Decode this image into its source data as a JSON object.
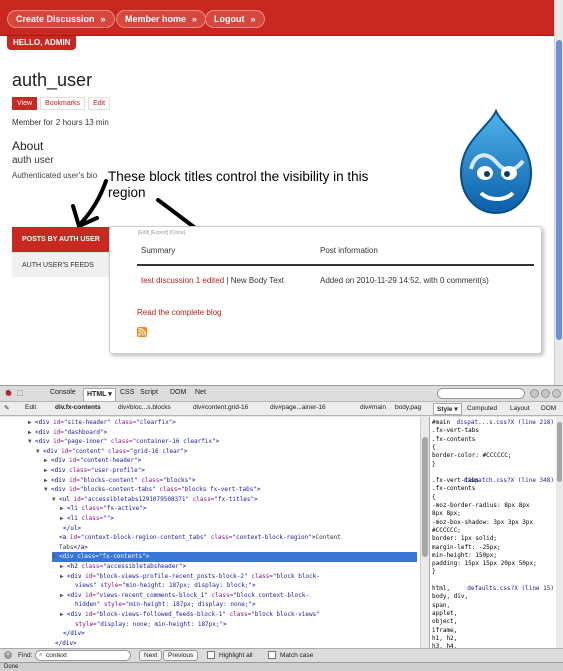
{
  "nav": {
    "create_discussion": "Create Discussion",
    "member_home": "Member home",
    "logout": "Logout",
    "hello": "HELLO, ADMIN"
  },
  "profile": {
    "title": "auth_user",
    "tabs": [
      "View",
      "Bookmarks",
      "Edit"
    ],
    "member_for_label": "Member for",
    "member_for_value": "2 hours 13 min",
    "about_heading": "About",
    "about_name": "auth user",
    "about_bio": "Authenticated user's bio"
  },
  "annotation": {
    "text": "These block titles control the visibility in this region"
  },
  "side_blocks": {
    "active": "POSTS BY AUTH USER",
    "inactive": "AUTH USER'S FEEDS"
  },
  "content": {
    "mini_links": "[Edit]  [Export]  [Clone]",
    "col_summary": "Summary",
    "col_post_info": "Post information",
    "row_link": "test discussion 1 edited",
    "row_separator": " | ",
    "row_body": "New Body Text",
    "row_info": "Added on 2010-11-29 14:52, with 0 comment(s)",
    "read_blog": "Read the complete blog"
  },
  "firebug": {
    "tabs": {
      "console": "Console",
      "html": "HTML ▾",
      "css": "CSS",
      "script": "Script",
      "dom": "DOM",
      "net": "Net"
    },
    "edit": "Edit",
    "breadcrumbs": [
      "div.fx-contents",
      "div#bloc...s.blocks",
      "div#content.grid-16",
      "div#page...ainer-16",
      "div#main",
      "body.pag"
    ],
    "side_tabs": {
      "style": "Style ▾",
      "computed": "Computed",
      "layout": "Layout",
      "dom": "DOM"
    },
    "find_label": "Find:",
    "find_value": "context",
    "find_next": "Next",
    "find_previous": "Previous",
    "highlight_all": "Highlight all",
    "match_case": "Match case",
    "status": "Done",
    "html_lines": [
      {
        "indent": 7,
        "tri": "▶",
        "parts": [
          [
            "tag",
            "<div "
          ],
          [
            "an",
            "id="
          ],
          [
            "av",
            "\"site-header\""
          ],
          [
            "an",
            " class="
          ],
          [
            "av",
            "\"clearfix\""
          ],
          [
            "tag",
            ">"
          ]
        ]
      },
      {
        "indent": 7,
        "tri": "▶",
        "parts": [
          [
            "tag",
            "<div "
          ],
          [
            "an",
            "id="
          ],
          [
            "av",
            "\"dashboard\""
          ],
          [
            "tag",
            ">"
          ]
        ]
      },
      {
        "indent": 7,
        "tri": "▼",
        "parts": [
          [
            "tag",
            "<div "
          ],
          [
            "an",
            "id="
          ],
          [
            "av",
            "\"page-inner\""
          ],
          [
            "an",
            " class="
          ],
          [
            "av",
            "\"container-16 clearfix\""
          ],
          [
            "tag",
            ">"
          ]
        ]
      },
      {
        "indent": 9,
        "tri": "▼",
        "parts": [
          [
            "tag",
            "<div "
          ],
          [
            "an",
            "id="
          ],
          [
            "av",
            "\"content\""
          ],
          [
            "an",
            " class="
          ],
          [
            "av",
            "\"grid-16 clear\""
          ],
          [
            "tag",
            ">"
          ]
        ]
      },
      {
        "indent": 11,
        "tri": "▶",
        "parts": [
          [
            "tag",
            "<div "
          ],
          [
            "an",
            "id="
          ],
          [
            "av",
            "\"content-header\""
          ],
          [
            "tag",
            ">"
          ]
        ]
      },
      {
        "indent": 11,
        "tri": "▶",
        "parts": [
          [
            "tag",
            "<div "
          ],
          [
            "an",
            "class="
          ],
          [
            "av",
            "\"user-profile\""
          ],
          [
            "tag",
            ">"
          ]
        ]
      },
      {
        "indent": 11,
        "tri": "▶",
        "parts": [
          [
            "tag",
            "<div "
          ],
          [
            "an",
            "id="
          ],
          [
            "av",
            "\"blocks-content\""
          ],
          [
            "an",
            " class="
          ],
          [
            "av",
            "\"blocks\""
          ],
          [
            "tag",
            ">"
          ]
        ]
      },
      {
        "indent": 11,
        "tri": "▼",
        "parts": [
          [
            "tag",
            "<div "
          ],
          [
            "an",
            "id="
          ],
          [
            "av",
            "\"blocks-content-tabs\""
          ],
          [
            "an",
            " class="
          ],
          [
            "av",
            "\"blocks fx-vert-tabs\""
          ],
          [
            "tag",
            ">"
          ]
        ]
      },
      {
        "indent": 13,
        "tri": "▼",
        "parts": [
          [
            "tag",
            "<ul "
          ],
          [
            "an",
            "id="
          ],
          [
            "av",
            "\"accessibletabs1291079508371\""
          ],
          [
            "an",
            " class="
          ],
          [
            "av",
            "\"fx-titles\""
          ],
          [
            "tag",
            ">"
          ]
        ]
      },
      {
        "indent": 15,
        "tri": "▶",
        "parts": [
          [
            "tag",
            "<li "
          ],
          [
            "an",
            "class="
          ],
          [
            "av",
            "\"fx-active\""
          ],
          [
            "tag",
            ">"
          ]
        ]
      },
      {
        "indent": 15,
        "tri": "▶",
        "parts": [
          [
            "tag",
            "<li "
          ],
          [
            "an",
            "class="
          ],
          [
            "av",
            "\"\""
          ],
          [
            "tag",
            ">"
          ]
        ]
      },
      {
        "indent": 14,
        "tri": "",
        "parts": [
          [
            "tag",
            "</ul>"
          ]
        ]
      },
      {
        "indent": 13,
        "tri": "",
        "parts": [
          [
            "tag",
            "<a "
          ],
          [
            "an",
            "id="
          ],
          [
            "av",
            "\"context-block-region-content_tabs\""
          ],
          [
            "an",
            " class="
          ],
          [
            "av",
            "\"context-block-region\""
          ],
          [
            "tag",
            ">"
          ],
          [
            "tx",
            "Content"
          ]
        ]
      },
      {
        "indent": 13,
        "tri": "",
        "parts": [
          [
            "tx",
            "Tabs"
          ],
          [
            "tag",
            "</a>"
          ]
        ]
      },
      {
        "indent": 13,
        "tri": "▼",
        "hl": true,
        "parts": [
          [
            "tag",
            "<div "
          ],
          [
            "an",
            "class="
          ],
          [
            "av",
            "\"fx-contents\""
          ],
          [
            "tag",
            ">"
          ]
        ]
      },
      {
        "indent": 15,
        "tri": "▶",
        "parts": [
          [
            "tag",
            "<h2 "
          ],
          [
            "an",
            "class="
          ],
          [
            "av",
            "\"accessibletabsheader\""
          ],
          [
            "tag",
            ">"
          ]
        ]
      },
      {
        "indent": 15,
        "tri": "▶",
        "parts": [
          [
            "tag",
            "<div "
          ],
          [
            "an",
            "id="
          ],
          [
            "av",
            "\"block-views-profile-recent_posts-block-2\""
          ],
          [
            "an",
            " class="
          ],
          [
            "av",
            "\"block block-"
          ]
        ]
      },
      {
        "indent": 17,
        "tri": "",
        "parts": [
          [
            "av",
            "views\""
          ],
          [
            "an",
            " style="
          ],
          [
            "av",
            "\"min-height: 187px; display: block;\""
          ],
          [
            "tag",
            ">"
          ]
        ]
      },
      {
        "indent": 15,
        "tri": "▶",
        "parts": [
          [
            "tag",
            "<div "
          ],
          [
            "an",
            "id="
          ],
          [
            "av",
            "\"views-recent_comments-block_1\""
          ],
          [
            "an",
            " class="
          ],
          [
            "av",
            "\"block context-block-"
          ]
        ]
      },
      {
        "indent": 17,
        "tri": "",
        "parts": [
          [
            "av",
            "hidden\""
          ],
          [
            "an",
            " style="
          ],
          [
            "av",
            "\"min-height: 187px; display: none;\""
          ],
          [
            "tag",
            ">"
          ]
        ]
      },
      {
        "indent": 15,
        "tri": "▶",
        "parts": [
          [
            "tag",
            "<div "
          ],
          [
            "an",
            "id="
          ],
          [
            "av",
            "\"block-views-followed_feeds-block-1\""
          ],
          [
            "an",
            " class="
          ],
          [
            "av",
            "\"block block-views\""
          ]
        ]
      },
      {
        "indent": 17,
        "tri": "",
        "parts": [
          [
            "an",
            "style="
          ],
          [
            "av",
            "\"display: none; min-height: 187px;\""
          ],
          [
            "tag",
            ">"
          ]
        ]
      },
      {
        "indent": 14,
        "tri": "",
        "parts": [
          [
            "tag",
            "</div>"
          ]
        ]
      },
      {
        "indent": 12,
        "tri": "",
        "parts": [
          [
            "tag",
            "</div>"
          ]
        ]
      },
      {
        "indent": 10,
        "tri": "",
        "parts": [
          [
            "tag",
            "</div>"
          ]
        ]
      }
    ],
    "style_lines": [
      {
        "text": "#main",
        "src": "dispat...s.css?X (line 218)"
      },
      {
        "text": ".fx-vert-tabs",
        "src": ""
      },
      {
        "text": ".fx-contents",
        "src": ""
      },
      {
        "text": "{",
        "src": ""
      },
      {
        "text": "  border-color: #CCCCCC;",
        "src": ""
      },
      {
        "text": "}",
        "src": ""
      },
      {
        "text": "",
        "src": ""
      },
      {
        "text": ".fx-vert-tabs",
        "src": "dispatch.css?X (line 348)"
      },
      {
        "text": ".fx-contents",
        "src": ""
      },
      {
        "text": "{",
        "src": ""
      },
      {
        "text": "  -moz-border-radius: 8px 8px",
        "src": ""
      },
      {
        "text": "  8px 8px;",
        "src": ""
      },
      {
        "text": "  -moz-box-shadow: 3px 3px 3px",
        "src": ""
      },
      {
        "text": "  #CCCCCC;",
        "src": ""
      },
      {
        "text": "  border: 1px solid;",
        "src": ""
      },
      {
        "text": "  margin-left: -25px;",
        "src": ""
      },
      {
        "text": "  min-height: 150px;",
        "src": ""
      },
      {
        "text": "  padding: 15px 15px 20px 50px;",
        "src": ""
      },
      {
        "text": "}",
        "src": ""
      },
      {
        "text": "",
        "src": ""
      },
      {
        "text": "html,",
        "src": "defaults.css?X (line 15)"
      },
      {
        "text": "body, div,",
        "src": ""
      },
      {
        "text": "span,",
        "src": ""
      },
      {
        "text": "applet,",
        "src": ""
      },
      {
        "text": "object,",
        "src": ""
      },
      {
        "text": "iframe,",
        "src": ""
      },
      {
        "text": "h1, h2,",
        "src": ""
      },
      {
        "text": "h3, h4,",
        "src": ""
      }
    ]
  },
  "colors": {
    "brand_red": "#c8281f",
    "link_red": "#b7231b",
    "selection_blue": "#3875d7"
  }
}
